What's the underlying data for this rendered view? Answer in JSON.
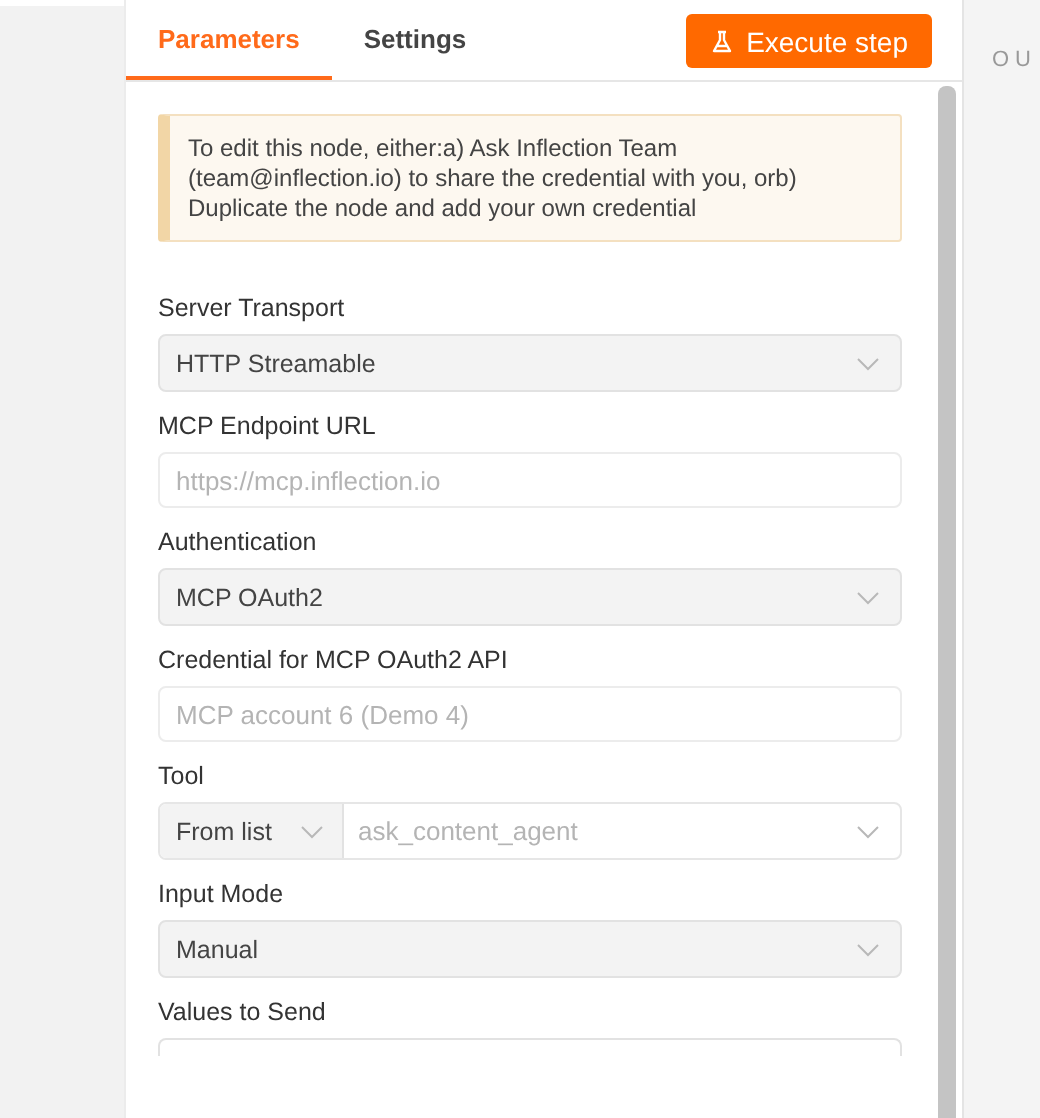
{
  "tabs": [
    {
      "label": "Parameters",
      "selected": true
    },
    {
      "label": "Settings",
      "selected": false
    }
  ],
  "execute_button": {
    "label": "Execute step"
  },
  "notice": "To edit this node, either:a) Ask Inflection Team (team@inflection.io) to share the credential with you, orb) Duplicate the node and add your own credential",
  "fields": [
    {
      "label": "Server Transport",
      "kind": "select",
      "value": "HTTP Streamable"
    },
    {
      "label": "MCP Endpoint URL",
      "kind": "input",
      "placeholder": "https://mcp.inflection.io"
    },
    {
      "label": "Authentication",
      "kind": "select",
      "value": "MCP OAuth2"
    },
    {
      "label": "Credential for MCP OAuth2 API",
      "kind": "input",
      "value": "MCP account 6 (Demo 4)",
      "disabled": true
    },
    {
      "label": "Tool",
      "kind": "combo",
      "mode": "From list",
      "value": "ask_content_agent",
      "disabled": true
    },
    {
      "label": "Input Mode",
      "kind": "select",
      "value": "Manual"
    },
    {
      "label": "Values to Send",
      "kind": "partial"
    }
  ],
  "output_pane": {
    "title": "OU"
  }
}
